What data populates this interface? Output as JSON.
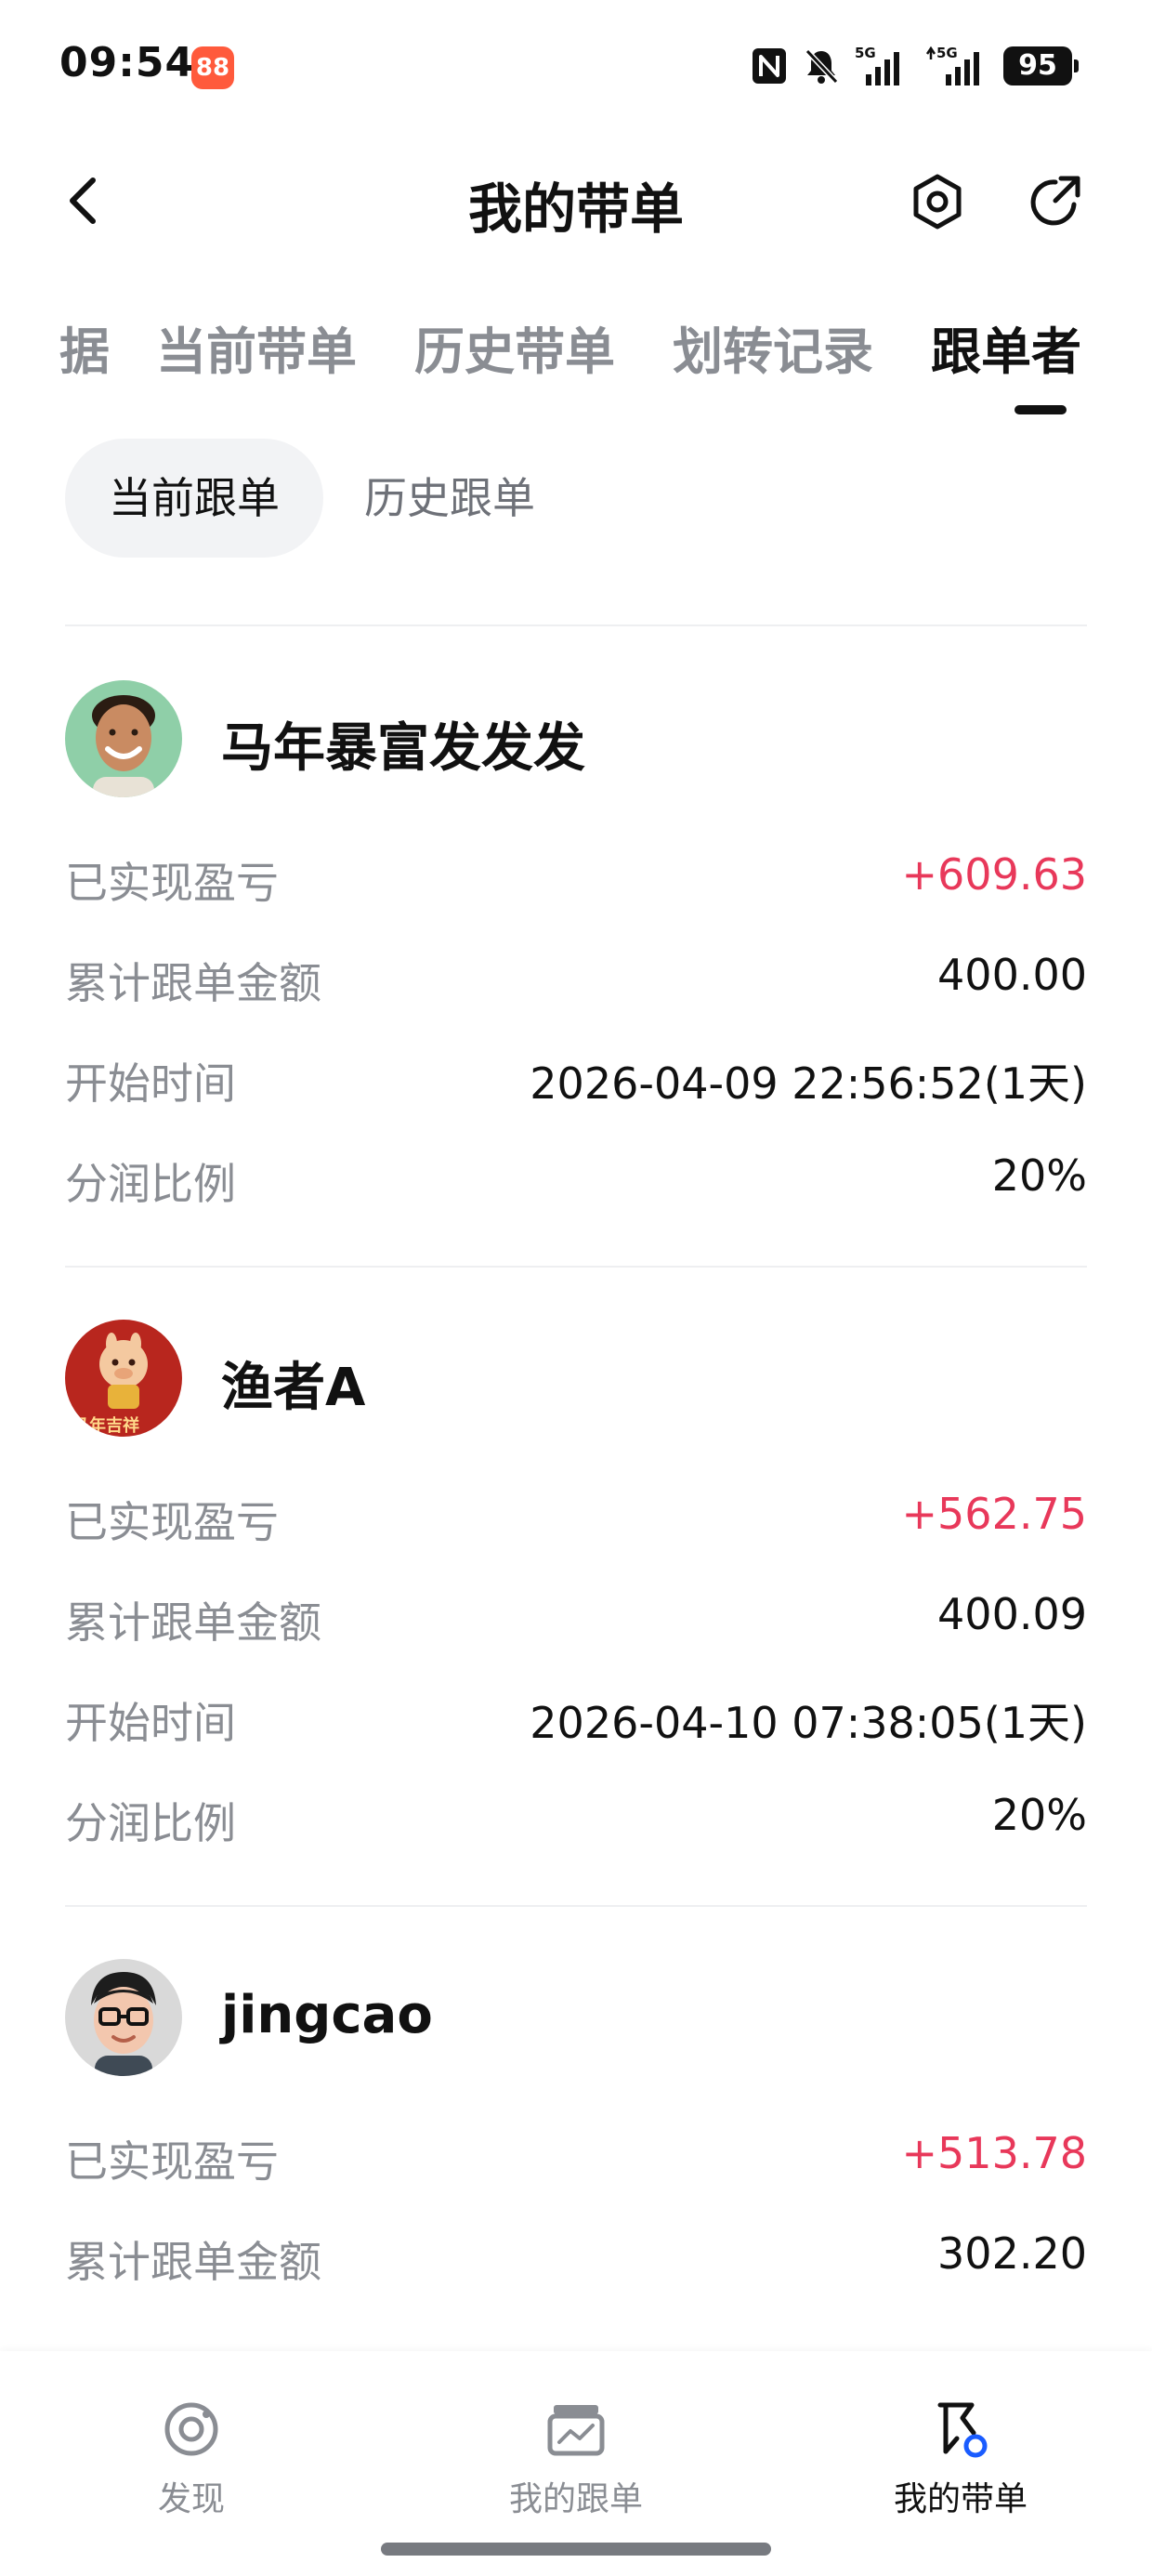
{
  "status_bar": {
    "time": "09:54",
    "app_badge": "88",
    "battery": "95",
    "network_1": "5G",
    "network_2": "5G",
    "icons": [
      "nfc-icon",
      "mute-bell-icon",
      "signal-5g-icon",
      "signal-5g-icon",
      "battery-icon"
    ]
  },
  "header": {
    "title": "我的带单",
    "back_icon": "chevron-left-icon",
    "settings_icon": "hexagon-gear-icon",
    "share_icon": "share-arrow-icon"
  },
  "tabs": [
    {
      "label": "据",
      "active": false
    },
    {
      "label": "当前带单",
      "active": false
    },
    {
      "label": "历史带单",
      "active": false
    },
    {
      "label": "划转记录",
      "active": false
    },
    {
      "label": "跟单者",
      "active": true
    }
  ],
  "segment": {
    "active_label": "当前跟单",
    "inactive_label": "历史跟单"
  },
  "followers": [
    {
      "name": "马年暴富发发发",
      "avatar": "smiling-man-avatar",
      "rows": [
        {
          "label": "已实现盈亏",
          "value": "+609.63"
        },
        {
          "label": "累计跟单金额",
          "value": "400.00"
        },
        {
          "label": "开始时间",
          "value": "2026-04-09 22:56:52(1天)"
        },
        {
          "label": "分润比例",
          "value": "20%"
        }
      ]
    },
    {
      "name": "渔者A",
      "avatar": "lucky-horse-avatar",
      "avatar_text": "马年吉祥",
      "rows": [
        {
          "label": "已实现盈亏",
          "value": "+562.75"
        },
        {
          "label": "累计跟单金额",
          "value": "400.09"
        },
        {
          "label": "开始时间",
          "value": "2026-04-10 07:38:05(1天)"
        },
        {
          "label": "分润比例",
          "value": "20%"
        }
      ]
    },
    {
      "name": "jingcao",
      "avatar": "cartoon-glasses-avatar",
      "rows": [
        {
          "label": "已实现盈亏",
          "value": "+513.78"
        },
        {
          "label": "累计跟单金额",
          "value": "302.20"
        }
      ]
    }
  ],
  "colors": {
    "profit": "#e8385a",
    "label_gray": "#8a8d93",
    "text": "#111111",
    "nav_active_dot": "#1a5cff"
  },
  "bottom_nav": [
    {
      "label": "发现",
      "icon": "discover-icon",
      "active": false
    },
    {
      "label": "我的跟单",
      "icon": "chart-card-icon",
      "active": false
    },
    {
      "label": "我的带单",
      "icon": "flag-icon",
      "active": true
    }
  ]
}
